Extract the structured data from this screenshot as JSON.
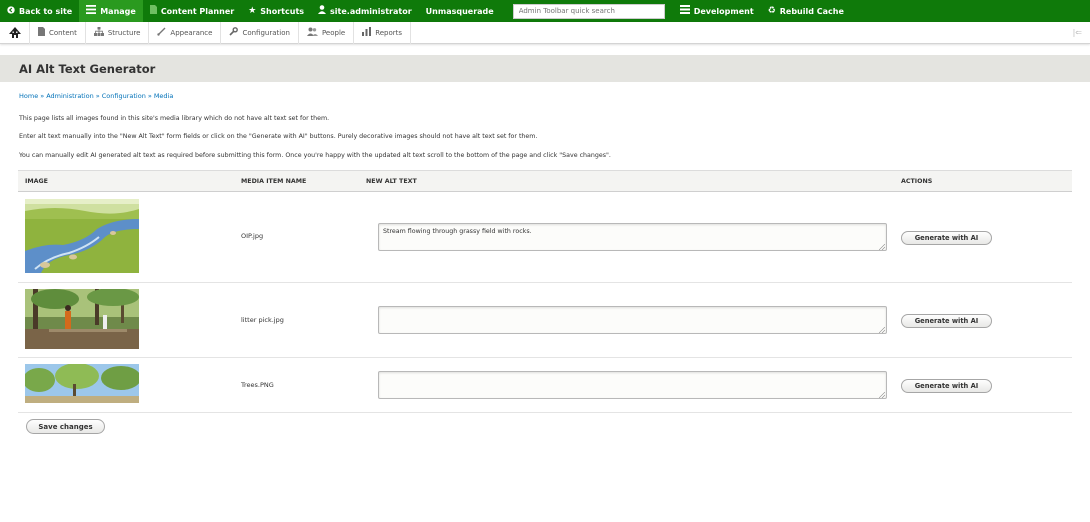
{
  "toolbar": {
    "back": "Back to site",
    "manage": "Manage",
    "content_planner": "Content Planner",
    "shortcuts": "Shortcuts",
    "user": "site.administrator",
    "unmasquerade": "Unmasquerade",
    "search_placeholder": "Admin Toolbar quick search",
    "development": "Development",
    "rebuild_cache": "Rebuild Cache"
  },
  "tray": {
    "items": [
      "Content",
      "Structure",
      "Appearance",
      "Configuration",
      "People",
      "Reports"
    ]
  },
  "page": {
    "title": "AI Alt Text Generator",
    "breadcrumb": [
      "Home",
      "Administration",
      "Configuration",
      "Media"
    ],
    "breadcrumb_sep": "»",
    "paragraphs": [
      "This page lists all images found in this site's media library which do not have alt text set for them.",
      "Enter alt text manually into the \"New Alt Text\" form fields or click on the \"Generate with AI\" buttons. Purely decorative images should not have alt text set for them.",
      "You can manually edit AI generated alt text as required before submitting this form. Once you're happy with the updated alt text scroll to the bottom of the page and click \"Save changes\"."
    ]
  },
  "table": {
    "headers": {
      "image": "IMAGE",
      "media_name": "MEDIA ITEM NAME",
      "alt": "NEW ALT TEXT",
      "actions": "ACTIONS"
    },
    "rows": [
      {
        "name": "OIP.jpg",
        "alt": "Stream flowing through grassy field with rocks.",
        "button": "Generate with AI"
      },
      {
        "name": "litter pick.jpg",
        "alt": "",
        "button": "Generate with AI"
      },
      {
        "name": "Trees.PNG",
        "alt": "",
        "button": "Generate with AI"
      }
    ]
  },
  "save_label": "Save changes",
  "colors": {
    "toolbar_green": "#0f7a0a",
    "link_blue": "#0071b8",
    "header_gray": "#e4e4e0"
  }
}
